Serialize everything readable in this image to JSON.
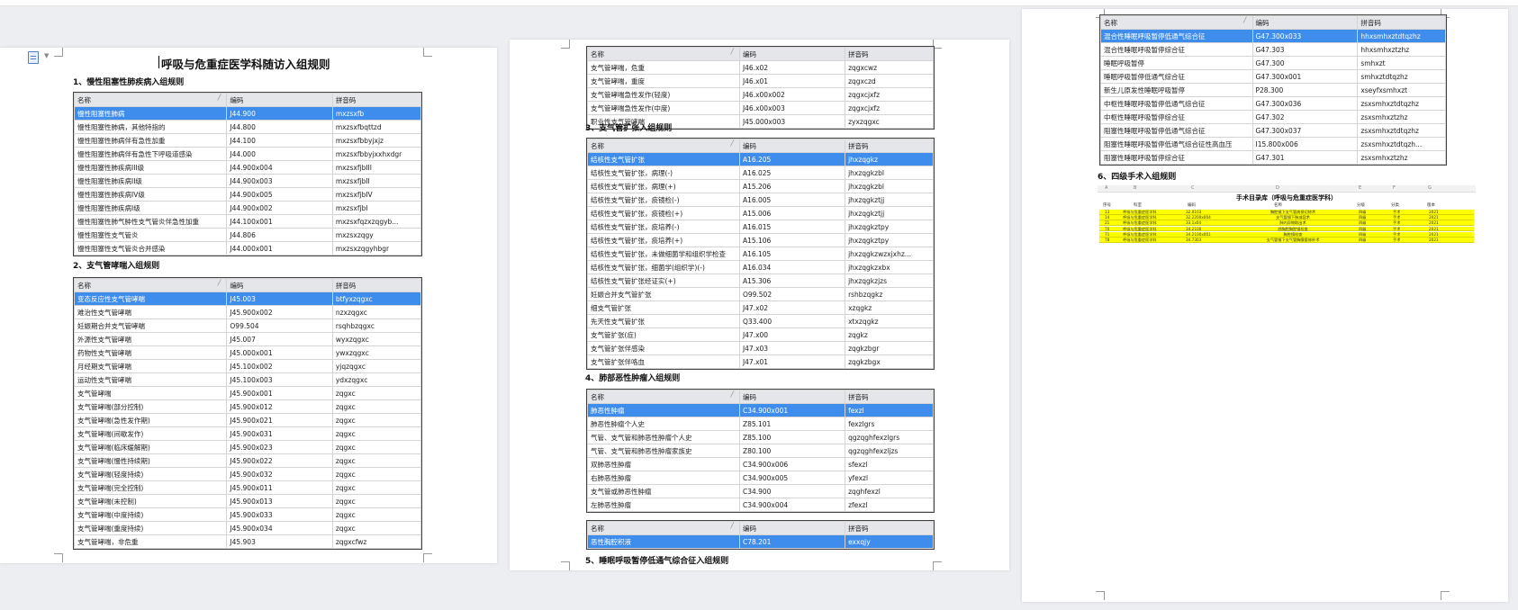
{
  "doc": {
    "title": "呼吸与危重症医学科随访入组规则",
    "headers": {
      "name": "名称",
      "code": "编码",
      "pinyin": "拼音码"
    },
    "sections": [
      {
        "title": "1、慢性阻塞性肺疾病入组规则",
        "rows": [
          [
            "慢性阻塞性肺病",
            "J44.900",
            "mxzsxfb"
          ],
          [
            "慢性阻塞性肺病，其他特指的",
            "J44.800",
            "mxzsxfbqttzd"
          ],
          [
            "慢性阻塞性肺病伴有急性加重",
            "J44.100",
            "mxzsxfbbyjxjz"
          ],
          [
            "慢性阻塞性肺病伴有急性下呼吸道感染",
            "J44.000",
            "mxzsxfbbyjxxhxdgr"
          ],
          [
            "慢性阻塞性肺疾病III级",
            "J44.900x004",
            "mxzsxfjbIII"
          ],
          [
            "慢性阻塞性肺疾病II级",
            "J44.900x003",
            "mxzsxfjbII"
          ],
          [
            "慢性阻塞性肺疾病IV级",
            "J44.900x005",
            "mxzsxfjbIV"
          ],
          [
            "慢性阻塞性肺疾病I级",
            "J44.900x002",
            "mxzsxfjbI"
          ],
          [
            "慢性阻塞性肺气肿性支气管炎伴急性加重",
            "J44.100x001",
            "mxzsxfqzxzqgyb..."
          ],
          [
            "慢性阻塞性支气管炎",
            "J44.806",
            "mxzsxzqgy"
          ],
          [
            "慢性阻塞性支气管炎合并感染",
            "J44.000x001",
            "mxzsxzqgyhbgr"
          ]
        ]
      },
      {
        "title": "2、支气管哮喘入组规则",
        "rows": [
          [
            "变态反应性支气管哮喘",
            "J45.003",
            "btfyxzqgxc"
          ],
          [
            "难治性支气管哮喘",
            "J45.900x002",
            "nzxzqgxc"
          ],
          [
            "妊娠期合并支气管哮喘",
            "O99.504",
            "rsqhbzqgxc"
          ],
          [
            "外源性支气管哮喘",
            "J45.007",
            "wyxzqgxc"
          ],
          [
            "药物性支气管哮喘",
            "J45.000x001",
            "ywxzqgxc"
          ],
          [
            "月经期支气管哮喘",
            "J45.100x002",
            "yjqzqgxc"
          ],
          [
            "运动性支气管哮喘",
            "J45.100x003",
            "ydxzqgxc"
          ],
          [
            "支气管哮喘",
            "J45.900x001",
            "zqgxc"
          ],
          [
            "支气管哮喘(部分控制)",
            "J45.900x012",
            "zqgxc"
          ],
          [
            "支气管哮喘(急性发作期)",
            "J45.900x021",
            "zqgxc"
          ],
          [
            "支气管哮喘(间歇发作)",
            "J45.900x031",
            "zqgxc"
          ],
          [
            "支气管哮喘(临床缓解期)",
            "J45.900x023",
            "zqgxc"
          ],
          [
            "支气管哮喘(慢性持续期)",
            "J45.900x022",
            "zqgxc"
          ],
          [
            "支气管哮喘(轻度持续)",
            "J45.900x032",
            "zqgxc"
          ],
          [
            "支气管哮喘(完全控制)",
            "J45.900x011",
            "zqgxc"
          ],
          [
            "支气管哮喘(未控制)",
            "J45.900x013",
            "zqgxc"
          ],
          [
            "支气管哮喘(中度持续)",
            "J45.900x033",
            "zqgxc"
          ],
          [
            "支气管哮喘(重度持续)",
            "J45.900x034",
            "zqgxc"
          ],
          [
            "支气管哮喘，非危重",
            "J45.903",
            "zqgxcfwz"
          ]
        ]
      },
      {
        "title": "",
        "rows": [
          [
            "支气管哮喘，危重",
            "J46.x02",
            "zqgxcwz"
          ],
          [
            "支气管哮喘，重度",
            "J46.x01",
            "zqgxczd"
          ],
          [
            "支气管哮喘急性发作(轻度)",
            "J46.x00x002",
            "zqgxcjxfz"
          ],
          [
            "支气管哮喘急性发作(中度)",
            "J46.x00x003",
            "zqgxcjxfz"
          ],
          [
            "职业性支气管哮喘",
            "J45.000x003",
            "zyxzqgxc"
          ]
        ]
      },
      {
        "title": "3、支气管扩张入组规则",
        "rows": [
          [
            "结核性支气管扩张",
            "A16.205",
            "jhxzqgkz"
          ],
          [
            "结核性支气管扩张，病理(-)",
            "A16.025",
            "jhxzqgkzbl"
          ],
          [
            "结核性支气管扩张，病理(+)",
            "A15.206",
            "jhxzqgkzbl"
          ],
          [
            "结核性支气管扩张，痰镜检(-)",
            "A16.005",
            "jhxzqgkztjj"
          ],
          [
            "结核性支气管扩张，痰镜检(+)",
            "A15.006",
            "jhxzqgkztjj"
          ],
          [
            "结核性支气管扩张，痰培养(-)",
            "A16.015",
            "jhxzqgkztpy"
          ],
          [
            "结核性支气管扩张，痰培养(+)",
            "A15.106",
            "jhxzqgkztpy"
          ],
          [
            "结核性支气管扩张，未做细菌学和组织学检查",
            "A16.105",
            "jhxzqgkzwzxjxhz..."
          ],
          [
            "结核性支气管扩张，细菌学(组织学)(-)",
            "A16.034",
            "jhxzqgkzxbx"
          ],
          [
            "结核性支气管扩张经证实(+)",
            "A15.306",
            "jhxzqgkzjzs"
          ],
          [
            "妊娠合并支气管扩张",
            "O99.502",
            "rshbzqgkz"
          ],
          [
            "细支气管扩张",
            "J47.x02",
            "xzqgkz"
          ],
          [
            "先天性支气管扩张",
            "Q33.400",
            "xtxzqgkz"
          ],
          [
            "支气管扩张(症)",
            "J47.x00",
            "zqgkz"
          ],
          [
            "支气管扩张伴感染",
            "J47.x03",
            "zqgkzbgr"
          ],
          [
            "支气管扩张伴咯血",
            "J47.x01",
            "zqgkzbgx"
          ]
        ]
      },
      {
        "title": "4、肺部恶性肿瘤入组规则",
        "rows": [
          [
            "肺恶性肿瘤",
            "C34.900x001",
            "fexzl"
          ],
          [
            "肺恶性肿瘤个人史",
            "Z85.101",
            "fexzlgrs"
          ],
          [
            "气管、支气管和肺恶性肿瘤个人史",
            "Z85.100",
            "qgzqghfexzlgrs"
          ],
          [
            "气管、支气管和肺恶性肿瘤家族史",
            "Z80.100",
            "qgzqghfexzljzs"
          ],
          [
            "双肺恶性肿瘤",
            "C34.900x006",
            "sfexzl"
          ],
          [
            "右肺恶性肿瘤",
            "C34.900x005",
            "yfexzl"
          ],
          [
            "支气管或肺恶性肿瘤",
            "C34.900",
            "zqghfexzl"
          ],
          [
            "左肺恶性肿瘤",
            "C34.900x004",
            "zfexzl"
          ]
        ]
      },
      {
        "title": "",
        "rows": [
          [
            "恶性胸腔积液",
            "C78.201",
            "exxqjy"
          ]
        ]
      },
      {
        "title": "5、睡眠呼吸暂停低通气综合征入组规则",
        "rows": [
          [
            "混合性睡眠呼吸暂停低通气综合征",
            "G47.300x033",
            "hhxsmhxztdtqzhz"
          ],
          [
            "混合性睡眠呼吸暂停综合征",
            "G47.303",
            "hhxsmhxztzhz"
          ],
          [
            "睡眠呼吸暂停",
            "G47.300",
            "smhxzt"
          ],
          [
            "睡眠呼吸暂停低通气综合征",
            "G47.300x001",
            "smhxztdtqzhz"
          ],
          [
            "新生儿原发性睡眠呼吸暂停",
            "P28.300",
            "xseyfxsmhxzt"
          ],
          [
            "中枢性睡眠呼吸暂停低通气综合征",
            "G47.300x036",
            "zsxsmhxztdtqzhz"
          ],
          [
            "中枢性睡眠呼吸暂停综合征",
            "G47.302",
            "zsxsmhxztzhz"
          ],
          [
            "阻塞性睡眠呼吸暂停低通气综合征",
            "G47.300x037",
            "zsxsmhxztdtqzhz"
          ],
          [
            "阻塞性睡眠呼吸暂停低通气综合征性高血压",
            "I15.800x006",
            "zsxsmhxztdtqzh..."
          ],
          [
            "阻塞性睡眠呼吸暂停综合征",
            "G47.301",
            "zsxsmhxztzhz"
          ]
        ]
      },
      {
        "title": "6、四级手术入组规则",
        "rows": []
      }
    ]
  },
  "sheet": {
    "title": "手术目录库（呼吸与危重症医学科）",
    "col_letters": [
      "A",
      "B",
      "C",
      "D",
      "E",
      "F",
      "G"
    ],
    "headers": [
      "序号",
      "科室",
      "编码",
      "名称",
      "分级",
      "分类",
      "版本"
    ],
    "rows": [
      [
        "13",
        "呼吸与危重症医学科",
        "32.0103",
        "胸腔镜下支气管病损切除术",
        "四级",
        "手术",
        "2021"
      ],
      [
        "14",
        "呼吸与危重症医学科",
        "32.2200x004",
        "支气管镜下肺减容术",
        "四级",
        "手术",
        "2021"
      ],
      [
        "21",
        "呼吸与危重症医学科",
        "33.1x04",
        "肺内异物取出术",
        "四级",
        "手术",
        "2021"
      ],
      [
        "70",
        "呼吸与危重症医学科",
        "34.2100",
        "经胸腔胸腔镜检查",
        "四级",
        "手术",
        "2021"
      ],
      [
        "71",
        "呼吸与危重症医学科",
        "34.2100x001",
        "胸腔镜检查",
        "四级",
        "手术",
        "2021"
      ],
      [
        "78",
        "呼吸与危重症医学科",
        "34.7303",
        "支气管镜下支气管胸膜瘘修补术",
        "四级",
        "手术",
        "2021"
      ]
    ]
  }
}
